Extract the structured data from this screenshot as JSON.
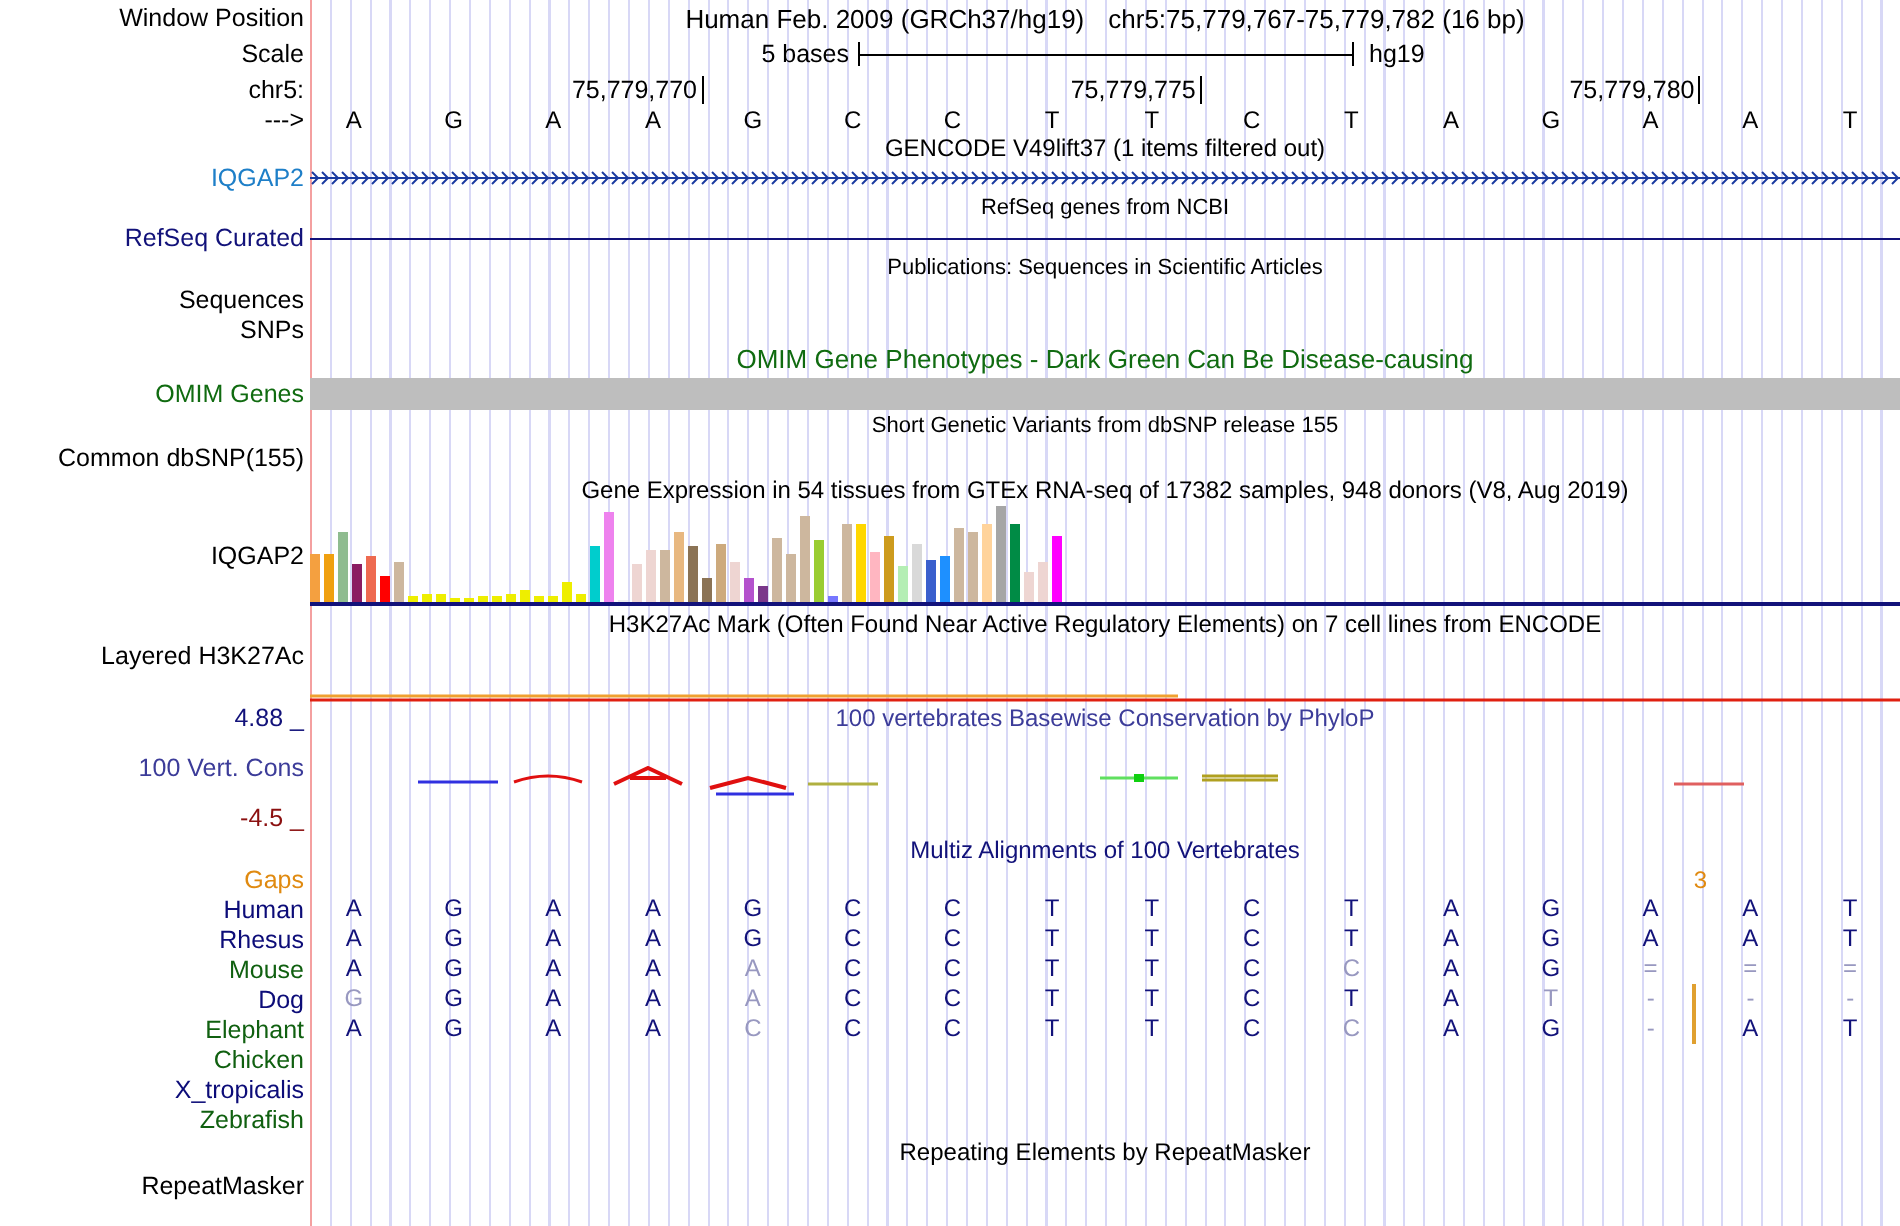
{
  "position": {
    "label": "Window Position",
    "assembly": "Human Feb. 2009 (GRCh37/hg19)",
    "range": "chr5:75,779,767-75,779,782 (16 bp)"
  },
  "scale": {
    "label": "Scale",
    "length": "5 bases",
    "assembly": "hg19"
  },
  "chromosome": {
    "label": "chr5:",
    "ticks": [
      "75,779,770",
      "75,779,775",
      "75,779,780"
    ]
  },
  "sequence": {
    "label": "--->",
    "bases": [
      "A",
      "G",
      "A",
      "A",
      "G",
      "C",
      "C",
      "T",
      "T",
      "C",
      "T",
      "A",
      "G",
      "A",
      "A",
      "T"
    ]
  },
  "gencode": {
    "title": "GENCODE V49lift37 (1 items filtered out)",
    "label": "IQGAP2"
  },
  "refseq": {
    "title": "RefSeq genes from NCBI",
    "label": "RefSeq Curated"
  },
  "publications": {
    "title": "Publications: Sequences in Scientific Articles",
    "labels": [
      "Sequences",
      "SNPs"
    ]
  },
  "omim": {
    "title": "OMIM Gene Phenotypes - Dark Green Can Be Disease-causing",
    "label": "OMIM Genes"
  },
  "dbsnp": {
    "title": "Short Genetic Variants from dbSNP release 155",
    "label": "Common dbSNP(155)"
  },
  "gtex": {
    "title": "Gene Expression in 54 tissues from GTEx RNA-seq of 17382 samples, 948 donors (V8, Aug 2019)",
    "label": "IQGAP2"
  },
  "h3k27ac": {
    "title": "H3K27Ac Mark (Often Found Near Active Regulatory Elements) on 7 cell lines from ENCODE",
    "label": "Layered H3K27Ac"
  },
  "phylop": {
    "title": "100 vertebrates Basewise Conservation by PhyloP",
    "label": "100 Vert. Cons",
    "max": "4.88 _",
    "min": "-4.5 _"
  },
  "multiz": {
    "title": "Multiz Alignments of 100 Vertebrates",
    "gaps": {
      "label": "Gaps",
      "count": "3"
    },
    "species": [
      {
        "name": "Human",
        "color": "#0c0c78",
        "insertion": false,
        "bases": [
          {
            "base": "A",
            "dim": false
          },
          {
            "base": "G",
            "dim": false
          },
          {
            "base": "A",
            "dim": false
          },
          {
            "base": "A",
            "dim": false
          },
          {
            "base": "G",
            "dim": false
          },
          {
            "base": "C",
            "dim": false
          },
          {
            "base": "C",
            "dim": false
          },
          {
            "base": "T",
            "dim": false
          },
          {
            "base": "T",
            "dim": false
          },
          {
            "base": "C",
            "dim": false
          },
          {
            "base": "T",
            "dim": false
          },
          {
            "base": "A",
            "dim": false
          },
          {
            "base": "G",
            "dim": false
          },
          {
            "base": "A",
            "dim": false
          },
          {
            "base": "A",
            "dim": false
          },
          {
            "base": "T",
            "dim": false
          }
        ]
      },
      {
        "name": "Rhesus",
        "color": "#0c0c78",
        "insertion": false,
        "bases": [
          {
            "base": "A",
            "dim": false
          },
          {
            "base": "G",
            "dim": false
          },
          {
            "base": "A",
            "dim": false
          },
          {
            "base": "A",
            "dim": false
          },
          {
            "base": "G",
            "dim": false
          },
          {
            "base": "C",
            "dim": false
          },
          {
            "base": "C",
            "dim": false
          },
          {
            "base": "T",
            "dim": false
          },
          {
            "base": "T",
            "dim": false
          },
          {
            "base": "C",
            "dim": false
          },
          {
            "base": "T",
            "dim": false
          },
          {
            "base": "A",
            "dim": false
          },
          {
            "base": "G",
            "dim": false
          },
          {
            "base": "A",
            "dim": false
          },
          {
            "base": "A",
            "dim": false
          },
          {
            "base": "T",
            "dim": false
          }
        ]
      },
      {
        "name": "Mouse",
        "color": "#106010",
        "insertion": false,
        "bases": [
          {
            "base": "A",
            "dim": false
          },
          {
            "base": "G",
            "dim": false
          },
          {
            "base": "A",
            "dim": false
          },
          {
            "base": "A",
            "dim": false
          },
          {
            "base": "A",
            "dim": true
          },
          {
            "base": "C",
            "dim": false
          },
          {
            "base": "C",
            "dim": false
          },
          {
            "base": "T",
            "dim": false
          },
          {
            "base": "T",
            "dim": false
          },
          {
            "base": "C",
            "dim": false
          },
          {
            "base": "C",
            "dim": true
          },
          {
            "base": "A",
            "dim": false
          },
          {
            "base": "G",
            "dim": false
          },
          {
            "base": "=",
            "dim": true
          },
          {
            "base": "=",
            "dim": true
          },
          {
            "base": "=",
            "dim": true
          }
        ]
      },
      {
        "name": "Dog",
        "color": "#0c0c78",
        "insertion": true,
        "bases": [
          {
            "base": "G",
            "dim": true
          },
          {
            "base": "G",
            "dim": false
          },
          {
            "base": "A",
            "dim": false
          },
          {
            "base": "A",
            "dim": false
          },
          {
            "base": "A",
            "dim": true
          },
          {
            "base": "C",
            "dim": false
          },
          {
            "base": "C",
            "dim": false
          },
          {
            "base": "T",
            "dim": false
          },
          {
            "base": "T",
            "dim": false
          },
          {
            "base": "C",
            "dim": false
          },
          {
            "base": "T",
            "dim": false
          },
          {
            "base": "A",
            "dim": false
          },
          {
            "base": "T",
            "dim": true
          },
          {
            "base": "-",
            "dim": true
          },
          {
            "base": "-",
            "dim": true
          },
          {
            "base": "-",
            "dim": true
          }
        ]
      },
      {
        "name": "Elephant",
        "color": "#106010",
        "insertion": true,
        "bases": [
          {
            "base": "A",
            "dim": false
          },
          {
            "base": "G",
            "dim": false
          },
          {
            "base": "A",
            "dim": false
          },
          {
            "base": "A",
            "dim": false
          },
          {
            "base": "C",
            "dim": true
          },
          {
            "base": "C",
            "dim": false
          },
          {
            "base": "C",
            "dim": false
          },
          {
            "base": "T",
            "dim": false
          },
          {
            "base": "T",
            "dim": false
          },
          {
            "base": "C",
            "dim": false
          },
          {
            "base": "C",
            "dim": true
          },
          {
            "base": "A",
            "dim": false
          },
          {
            "base": "G",
            "dim": false
          },
          {
            "base": "-",
            "dim": true
          },
          {
            "base": "A",
            "dim": false
          },
          {
            "base": "T",
            "dim": false
          }
        ]
      },
      {
        "name": "Chicken",
        "color": "#106010",
        "insertion": false
      },
      {
        "name": "X_tropicalis",
        "color": "#0c0c78",
        "insertion": false
      },
      {
        "name": "Zebrafish",
        "color": "#106010",
        "insertion": false
      }
    ]
  },
  "repeatmasker": {
    "title": "Repeating Elements by RepeatMasker",
    "label": "RepeatMasker"
  }
}
